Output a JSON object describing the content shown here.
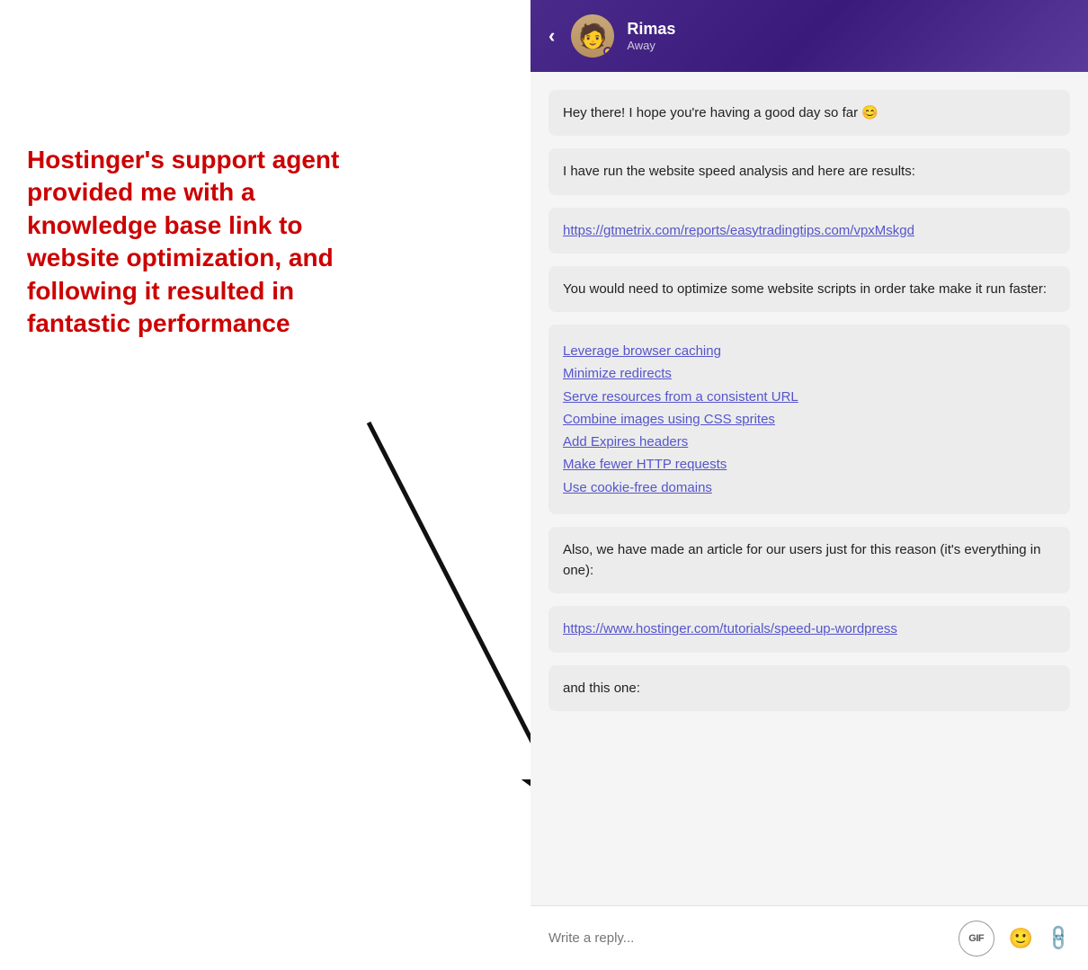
{
  "annotation": {
    "text": "Hostinger's support agent provided me with a knowledge base link to website optimization, and following it resulted in fantastic performance"
  },
  "chat": {
    "header": {
      "back_label": "‹",
      "agent_name": "Rimas",
      "agent_status": "Away"
    },
    "messages": [
      {
        "id": "msg1",
        "text": "Hey there! I hope you're having a good day so far 😊"
      },
      {
        "id": "msg2",
        "text": "I have run the website speed analysis and here are results:"
      },
      {
        "id": "msg3_link",
        "text": "https://gtmetrix.com/reports/easytradingtips.com/vpxMskgd"
      },
      {
        "id": "msg4",
        "text": "You would need to optimize some website scripts in order take make it run faster:"
      },
      {
        "id": "msg5_links",
        "links": [
          "Leverage browser caching",
          "Minimize redirects",
          "Serve resources from a consistent URL",
          "Combine images using CSS sprites",
          "Add Expires headers",
          "Make fewer HTTP requests",
          "Use cookie-free domains"
        ]
      },
      {
        "id": "msg6",
        "text": "Also, we have made an article for our users just for this reason (it's everything in one):"
      },
      {
        "id": "msg7_link",
        "text": "https://www.hostinger.com/tutorials/speed-up-wordpress"
      },
      {
        "id": "msg8",
        "text": "and this one:"
      }
    ],
    "footer": {
      "placeholder": "Write a reply...",
      "gif_label": "GIF",
      "emoji_icon": "😊",
      "attach_icon": "📎"
    }
  }
}
